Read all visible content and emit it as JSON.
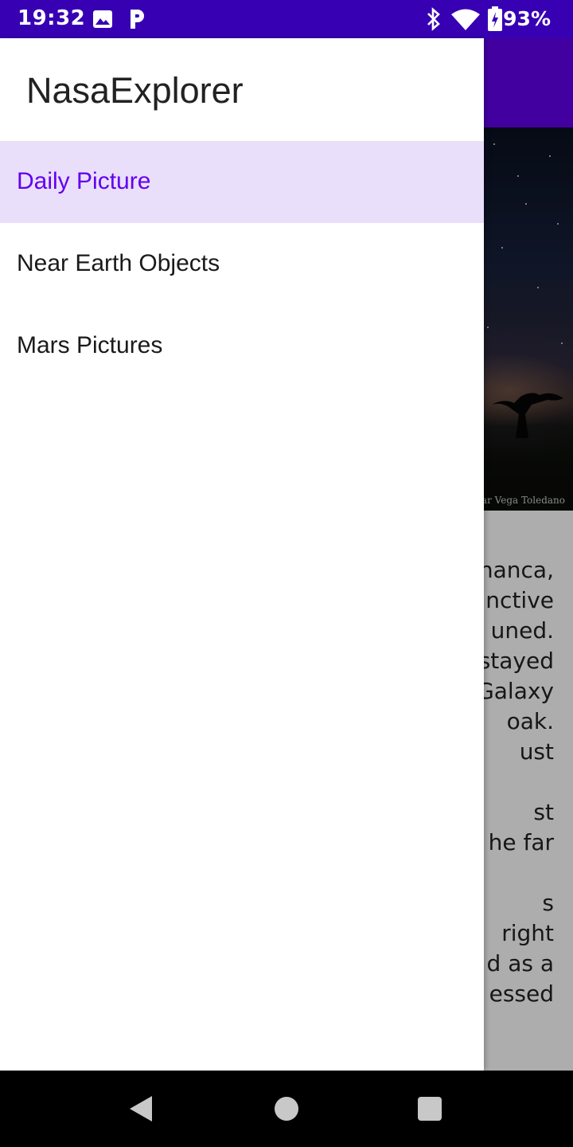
{
  "status_bar": {
    "time": "19:32",
    "battery_percent": "93%",
    "icons": [
      "image-icon",
      "parking-icon",
      "bluetooth-icon",
      "wifi-icon",
      "battery-charging-icon"
    ]
  },
  "drawer": {
    "title": "NasaExplorer",
    "items": [
      {
        "label": "Daily Picture",
        "active": true
      },
      {
        "label": "Near Earth Objects",
        "active": false
      },
      {
        "label": "Mars Pictures",
        "active": false
      }
    ]
  },
  "background": {
    "image_credit": "Cesar Vega Toledano",
    "article_lines": [
      "nanca,",
      "nctive",
      "uned.",
      "stayed",
      "Galaxy",
      "oak.",
      "ust",
      "",
      "st",
      "he far",
      "",
      "s",
      "right",
      "d as a",
      "essed"
    ]
  },
  "colors": {
    "status_bar": "#3700B3",
    "app_bar": "#6200EE",
    "active_item_bg": "#EADFFB",
    "active_item_text": "#6200EE"
  },
  "navigation_bar": {
    "buttons": [
      "back-icon",
      "home-icon",
      "recents-icon"
    ]
  }
}
